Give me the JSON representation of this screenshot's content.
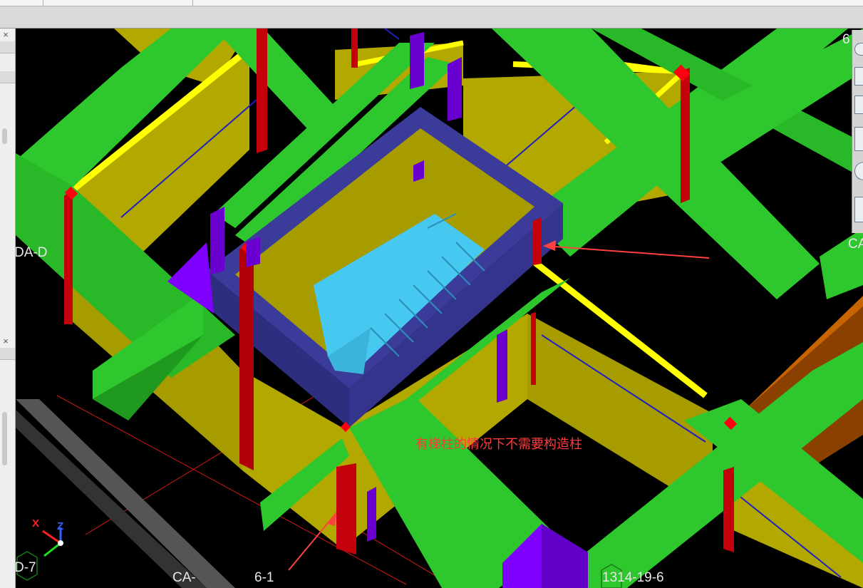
{
  "window": {
    "close_glyph": "×"
  },
  "viewport": {
    "annotation_text": "有梯柱的情况下不需要构造柱",
    "axis_labels": {
      "left_upper": "DA-D",
      "left_lower": "D-7",
      "bottom_ca": "CA-",
      "bottom_6_1": "6-1",
      "bottom_right": "1314-19-6",
      "top_right": "6",
      "right_ca": "CA"
    },
    "ucs": {
      "x": "X",
      "z": "Z"
    },
    "colors": {
      "background": "#000000",
      "beam_green": "#2ec82e",
      "wall_yellow": "#b3a800",
      "wall_top_yellow": "#ffff00",
      "stair_wall_blue": "#3b3b9a",
      "stair_cyan": "#46c8f0",
      "column_red": "#c4000a",
      "column_purple": "#7f00ff",
      "ortho_beam_orange": "#8a4000",
      "annotation_red": "#ff3b3b"
    }
  },
  "right_toolbar": {
    "icons": [
      "orbit-icon",
      "view-front-icon",
      "view-iso-icon",
      "view-box-icon",
      "circle-icon",
      "calculator-icon"
    ]
  }
}
